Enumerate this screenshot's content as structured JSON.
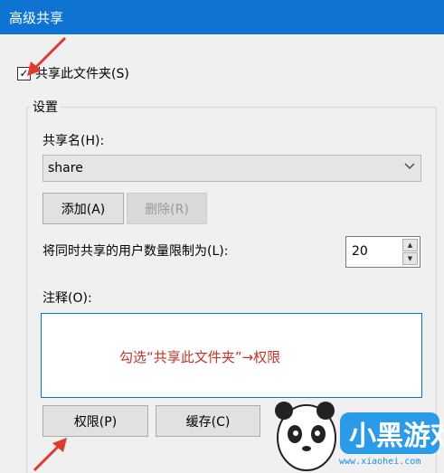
{
  "window": {
    "title": "高级共享"
  },
  "share_checkbox": {
    "label": "共享此文件夹(S)",
    "checked": true
  },
  "settings": {
    "group_label": "设置",
    "share_name_label": "共享名(H):",
    "share_name_value": "share",
    "add_button": "添加(A)",
    "remove_button": "删除(R)",
    "user_limit_label": "将同时共享的用户数量限制为(L):",
    "user_limit_value": "20",
    "comment_label": "注释(O):"
  },
  "buttons": {
    "permissions": "权限(P)",
    "caching": "缓存(C)"
  },
  "annotation": {
    "text": "勾选“共享此文件夹”→权限",
    "color": "#c0342a"
  },
  "watermark": {
    "brand": "小黑游戏",
    "url": "www.xiaohei.com"
  },
  "colors": {
    "titlebar": "#0f73d2",
    "arrow": "#e03a2e",
    "focus_border": "#0078d7"
  }
}
